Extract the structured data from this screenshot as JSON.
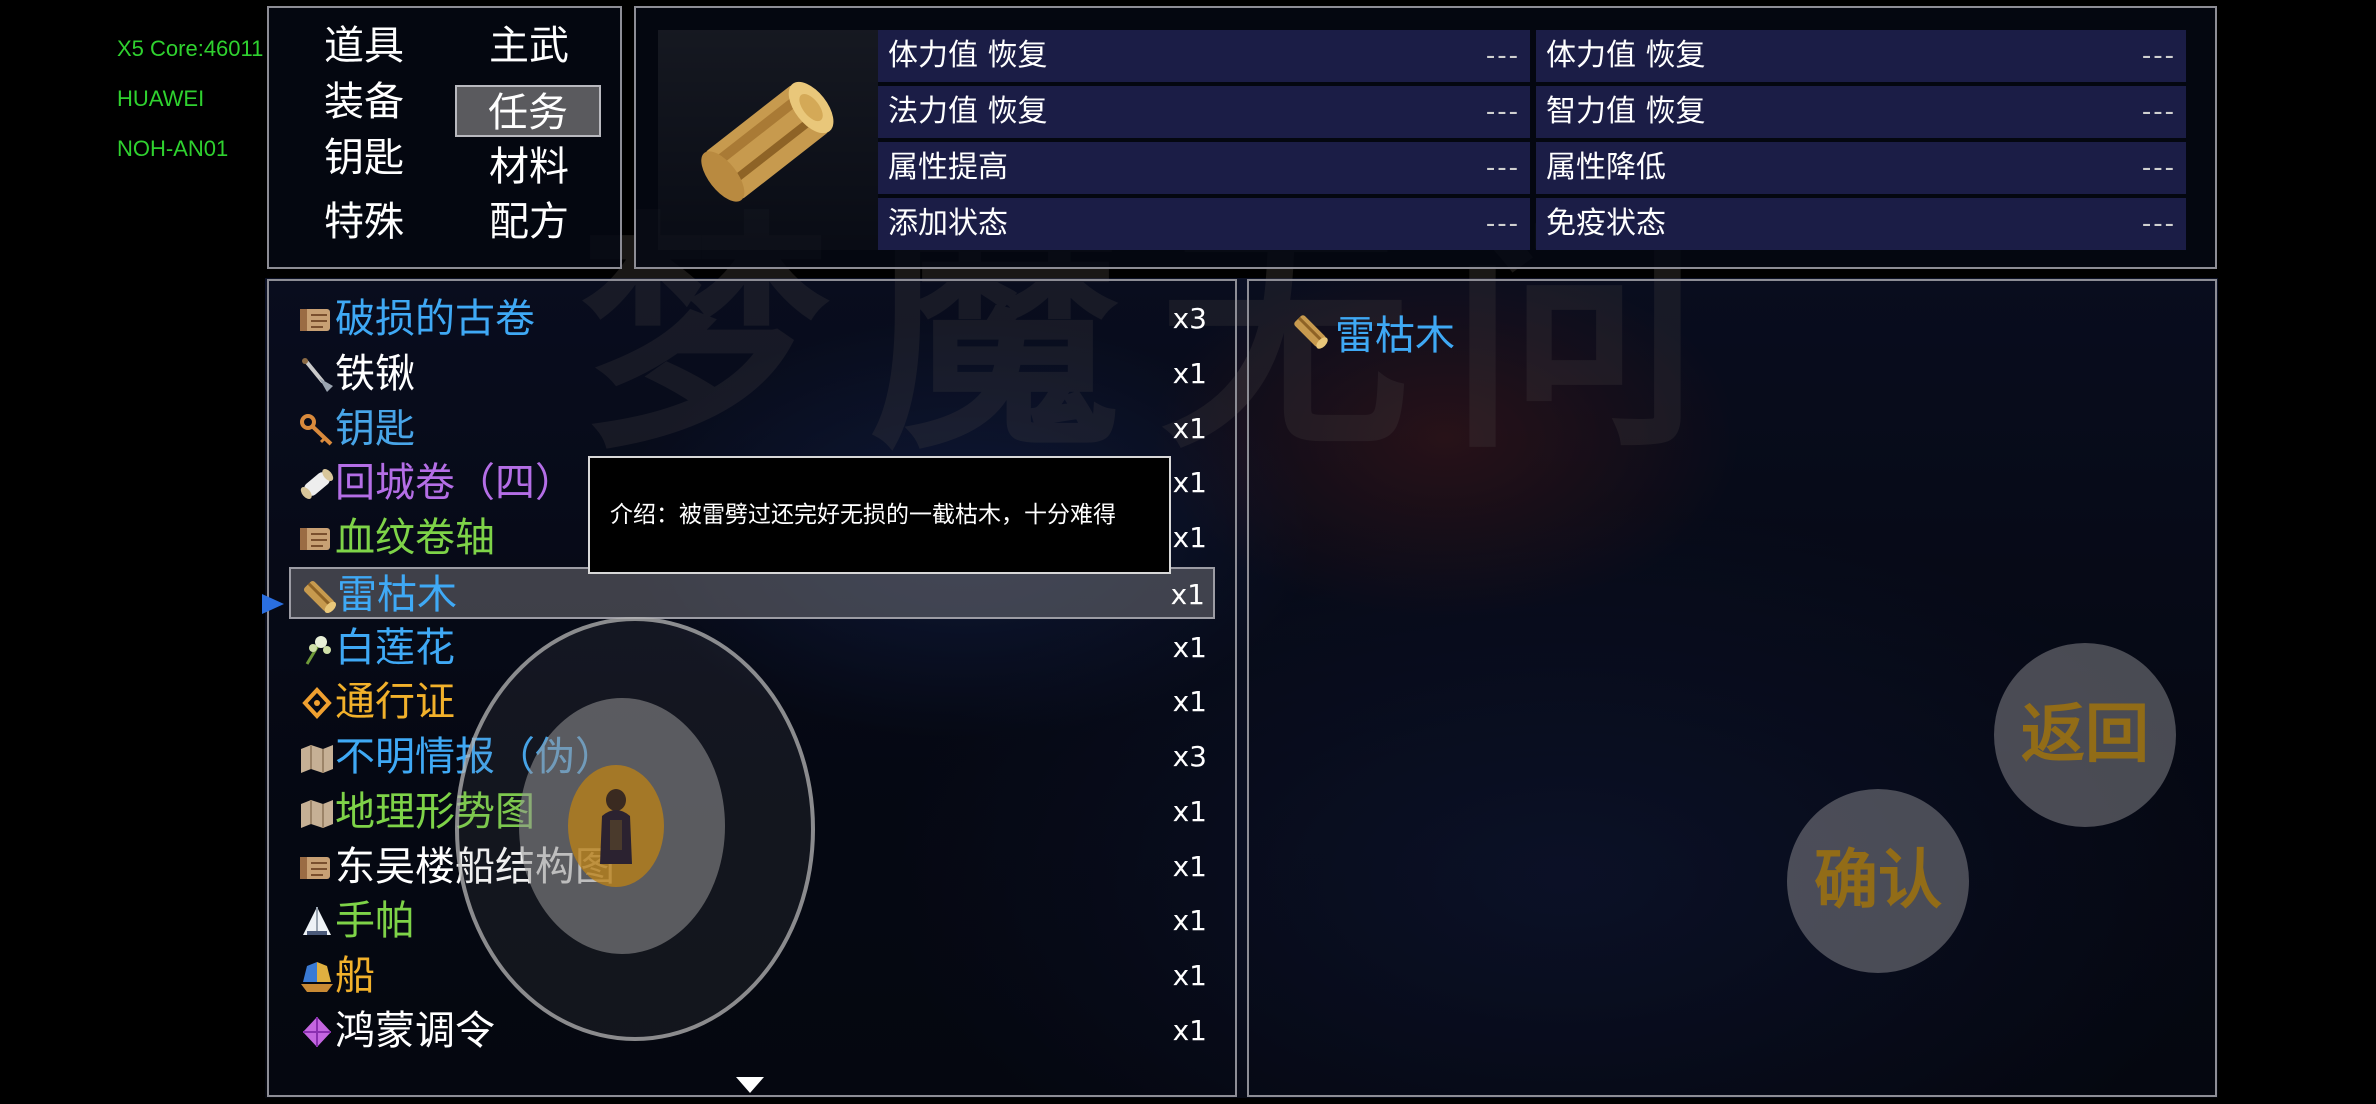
{
  "debug_info": [
    "X5 Core:46011",
    "HUAWEI",
    "NOH-AN01"
  ],
  "background_title": "梦魔无问",
  "tabs": [
    {
      "label": "道具",
      "active": false
    },
    {
      "label": "主武",
      "active": false
    },
    {
      "label": "装备",
      "active": false
    },
    {
      "label": "任务",
      "active": true
    },
    {
      "label": "钥匙",
      "active": false
    },
    {
      "label": "材料",
      "active": false
    },
    {
      "label": "特殊",
      "active": false
    },
    {
      "label": "配方",
      "active": false
    }
  ],
  "attributes": [
    {
      "label": "体力值  恢复",
      "value": "---"
    },
    {
      "label": "体力值  恢复",
      "value": "---"
    },
    {
      "label": "法力值  恢复",
      "value": "---"
    },
    {
      "label": "智力值  恢复",
      "value": "---"
    },
    {
      "label": "属性提高",
      "value": "---"
    },
    {
      "label": "属性降低",
      "value": "---"
    },
    {
      "label": "添加状态",
      "value": "---"
    },
    {
      "label": "免疫状态",
      "value": "---"
    }
  ],
  "items": [
    {
      "name": "破损的古卷",
      "qty": "x3",
      "color": "#3fa9f5",
      "icon": "scroll-icon"
    },
    {
      "name": "铁锹",
      "qty": "x1",
      "color": "#ffffff",
      "icon": "shovel-icon"
    },
    {
      "name": "钥匙",
      "qty": "x1",
      "color": "#48a5e8",
      "icon": "key-icon"
    },
    {
      "name": "回城卷（四）",
      "qty": "x1",
      "color": "#b46ee6",
      "icon": "rolled-scroll-icon"
    },
    {
      "name": "血纹卷轴",
      "qty": "x1",
      "color": "#7ed348",
      "icon": "scroll-icon"
    },
    {
      "name": "雷枯木",
      "qty": "x1",
      "color": "#3fa9f5",
      "icon": "log-icon",
      "selected": true
    },
    {
      "name": "白莲花",
      "qty": "x1",
      "color": "#3fa9f5",
      "icon": "flower-icon"
    },
    {
      "name": "通行证",
      "qty": "x1",
      "color": "#f2b12b",
      "icon": "pass-icon"
    },
    {
      "name": "不明情报（伪）",
      "qty": "x3",
      "color": "#3fa9f5",
      "icon": "map-icon"
    },
    {
      "name": "地理形势图",
      "qty": "x1",
      "color": "#7ed348",
      "icon": "map-icon"
    },
    {
      "name": "东吴楼船结构图",
      "qty": "x1",
      "color": "#ffffff",
      "icon": "scroll-icon"
    },
    {
      "name": "手帕",
      "qty": "x1",
      "color": "#7ed348",
      "icon": "handkerchief-icon"
    },
    {
      "name": "船",
      "qty": "x1",
      "color": "#f2b12b",
      "icon": "ship-icon"
    },
    {
      "name": "鸿蒙调令",
      "qty": "x1",
      "color": "#ffffff",
      "icon": "gem-icon"
    }
  ],
  "detail": {
    "name": "雷枯木"
  },
  "tooltip": {
    "text": "介绍：被雷劈过还完好无损的一截枯木，十分难得"
  },
  "buttons": {
    "back": "返回",
    "confirm": "确认"
  }
}
